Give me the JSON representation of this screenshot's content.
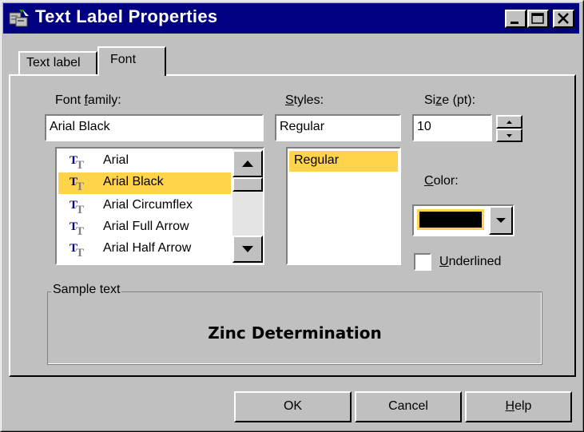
{
  "window": {
    "title": "Text Label Properties",
    "icon": "app-icon"
  },
  "title_buttons": {
    "minimize": "minimize-icon",
    "maximize": "maximize-icon",
    "close": "close-icon"
  },
  "tabs": [
    {
      "label": "Text label",
      "active": false
    },
    {
      "label": "Font",
      "active": true
    }
  ],
  "font_family": {
    "label_prefix": "Font ",
    "label_mnemonic": "f",
    "label_suffix": "amily:",
    "value": "Arial Black",
    "items": [
      "Arial",
      "Arial Black",
      "Arial Circumflex",
      "Arial Full Arrow",
      "Arial Half Arrow"
    ],
    "selected_index": 1,
    "item_icon": "truetype-icon"
  },
  "styles": {
    "label_mnemonic": "S",
    "label_suffix": "tyles:",
    "value": "Regular",
    "items": [
      "Regular"
    ],
    "selected_index": 0
  },
  "size": {
    "label_prefix": "Si",
    "label_mnemonic": "z",
    "label_suffix": "e (pt):",
    "value": "10"
  },
  "color": {
    "label_mnemonic": "C",
    "label_suffix": "olor:",
    "value_hex": "#000000"
  },
  "underlined": {
    "label_mnemonic": "U",
    "label_suffix": "nderlined",
    "checked": false
  },
  "sample": {
    "group_label": "Sample text",
    "text": "Zinc Determination"
  },
  "buttons": {
    "ok": "OK",
    "cancel": "Cancel",
    "help_mnemonic": "H",
    "help_suffix": "elp"
  },
  "colors": {
    "titlebar": "#000080",
    "selection": "#ffd34a",
    "face": "#c0c0c0"
  }
}
